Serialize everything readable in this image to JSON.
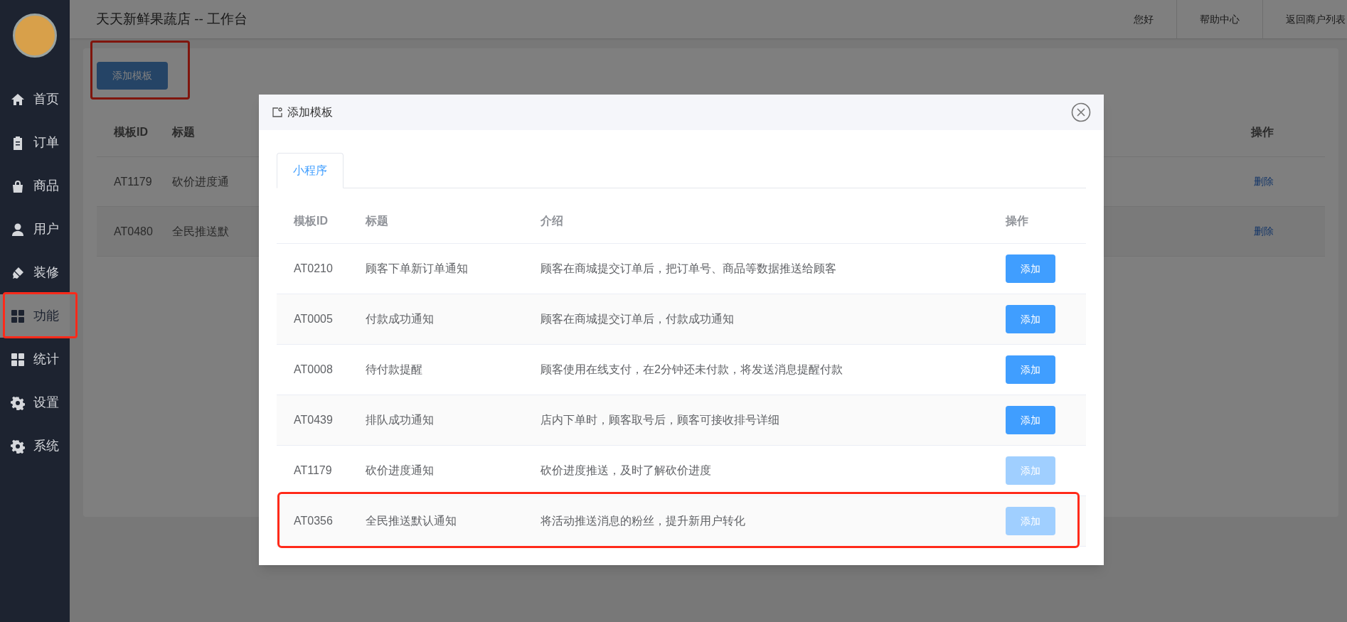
{
  "sidebar": {
    "items": [
      {
        "label": "首页",
        "selected": false,
        "highlighted": false
      },
      {
        "label": "订单",
        "selected": false,
        "highlighted": false
      },
      {
        "label": "商品",
        "selected": false,
        "highlighted": false
      },
      {
        "label": "用户",
        "selected": false,
        "highlighted": false
      },
      {
        "label": "装修",
        "selected": false,
        "highlighted": false
      },
      {
        "label": "功能",
        "selected": true,
        "highlighted": true
      },
      {
        "label": "统计",
        "selected": false,
        "highlighted": false
      },
      {
        "label": "设置",
        "selected": false,
        "highlighted": false
      },
      {
        "label": "系统",
        "selected": false,
        "highlighted": false
      }
    ]
  },
  "header": {
    "title": "天天新鲜果蔬店 -- 工作台",
    "links": [
      "您好",
      "帮助中心",
      "返回商户列表"
    ]
  },
  "page": {
    "add_button": {
      "label": "添加模板",
      "highlighted": true
    },
    "table": {
      "columns": [
        "模板ID",
        "标题",
        "操作"
      ],
      "rows": [
        {
          "id": "AT1179",
          "title": "砍价进度通",
          "action": "删除"
        },
        {
          "id": "AT0480",
          "title": "全民推送默",
          "action": "删除"
        }
      ]
    }
  },
  "modal": {
    "title": "添加模板",
    "tabs": [
      {
        "label": "小程序",
        "selected": true
      }
    ],
    "table": {
      "columns": [
        "模板ID",
        "标题",
        "介绍",
        "操作"
      ],
      "rows": [
        {
          "id": "AT0210",
          "title": "顾客下单新订单通知",
          "description": "顾客在商城提交订单后，把订单号、商品等数据推送给顾客",
          "button": "添加",
          "disabled": false,
          "highlighted": false
        },
        {
          "id": "AT0005",
          "title": "付款成功通知",
          "description": "顾客在商城提交订单后，付款成功通知",
          "button": "添加",
          "disabled": false,
          "highlighted": false
        },
        {
          "id": "AT0008",
          "title": "待付款提醒",
          "description": "顾客使用在线支付，在2分钟还未付款，将发送消息提醒付款",
          "button": "添加",
          "disabled": false,
          "highlighted": false
        },
        {
          "id": "AT0439",
          "title": "排队成功通知",
          "description": "店内下单时，顾客取号后，顾客可接收排号详细",
          "button": "添加",
          "disabled": false,
          "highlighted": false
        },
        {
          "id": "AT1179",
          "title": "砍价进度通知",
          "description": "砍价进度推送，及时了解砍价进度",
          "button": "添加",
          "disabled": true,
          "highlighted": false
        },
        {
          "id": "AT0356",
          "title": "全民推送默认通知",
          "description": "将活动推送消息的粉丝，提升新用户转化",
          "button": "添加",
          "disabled": true,
          "highlighted": true
        }
      ]
    }
  }
}
